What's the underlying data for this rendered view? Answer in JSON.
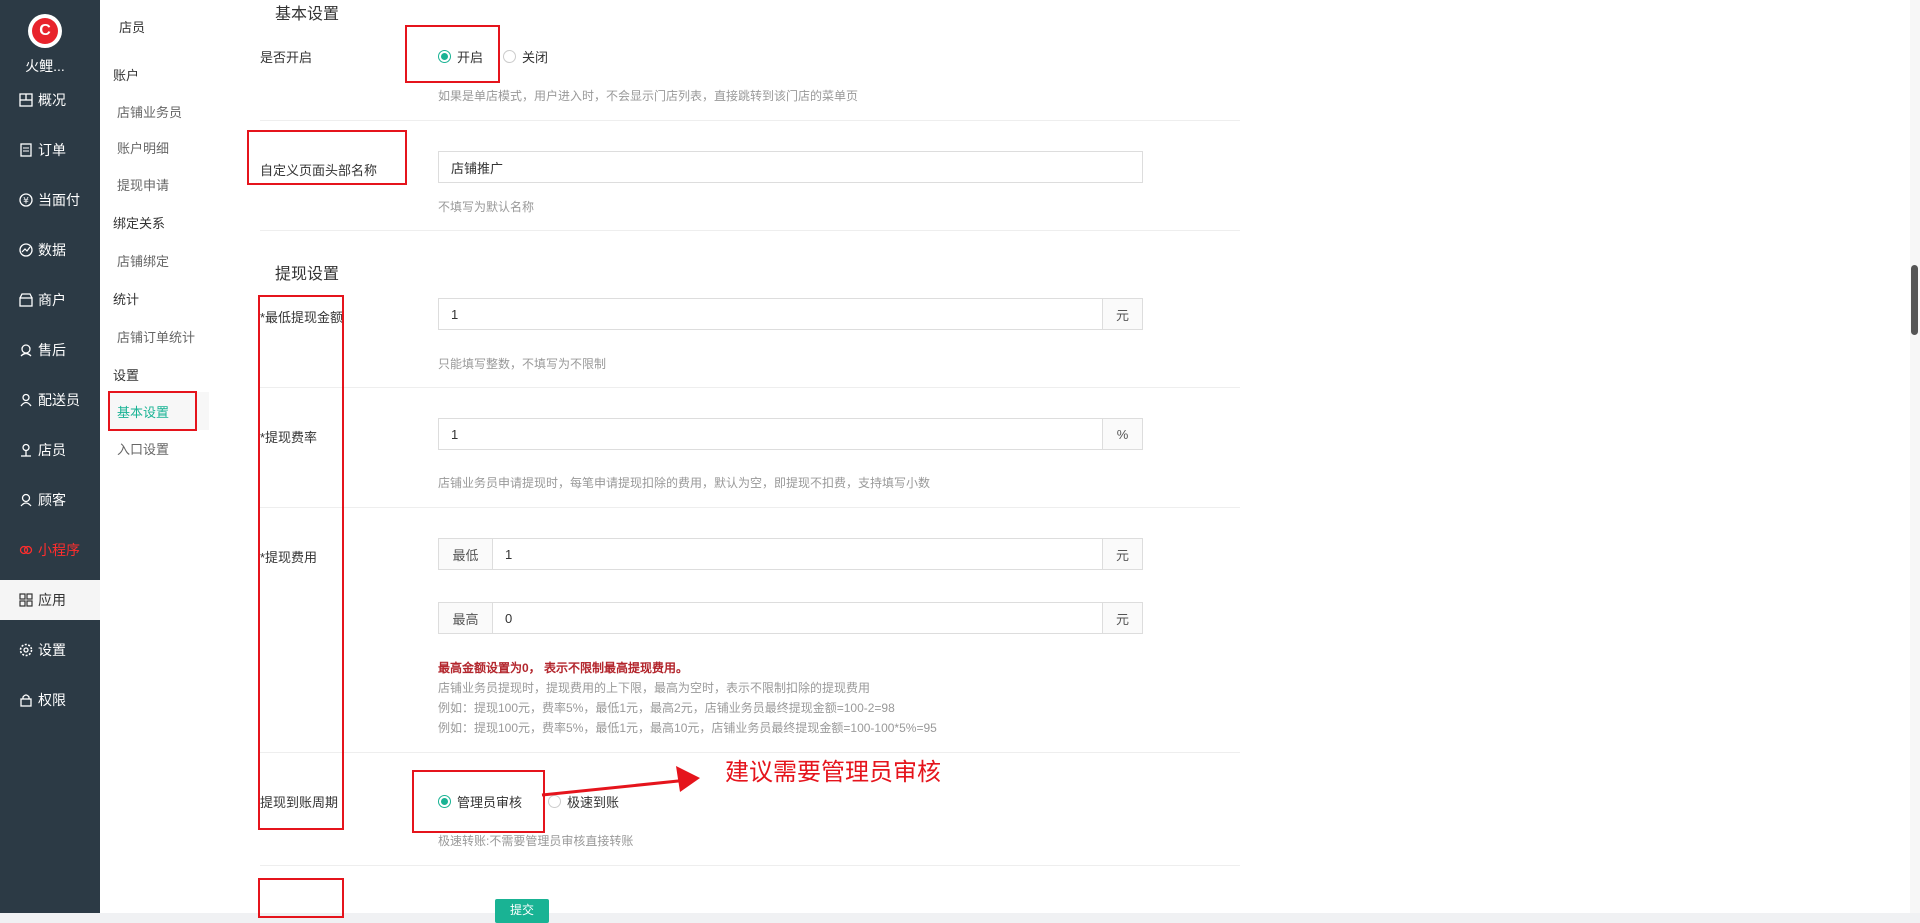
{
  "sidebar": {
    "shop_name": "火鲤...",
    "items": [
      {
        "label": "概况",
        "icon": "dashboard-icon"
      },
      {
        "label": "订单",
        "icon": "order-icon"
      },
      {
        "label": "当面付",
        "icon": "yen-icon"
      },
      {
        "label": "数据",
        "icon": "chart-icon"
      },
      {
        "label": "商户",
        "icon": "store-icon"
      },
      {
        "label": "售后",
        "icon": "service-icon"
      },
      {
        "label": "配送员",
        "icon": "courier-icon"
      },
      {
        "label": "店员",
        "icon": "clerk-icon"
      },
      {
        "label": "顾客",
        "icon": "customer-icon"
      },
      {
        "label": "小程序",
        "icon": "miniapp-icon"
      },
      {
        "label": "应用",
        "icon": "apps-icon"
      },
      {
        "label": "设置",
        "icon": "gear-icon"
      },
      {
        "label": "权限",
        "icon": "lock-icon"
      }
    ],
    "active_index": 10,
    "highlight_color": "#ff2d2d"
  },
  "subnav": {
    "top_item": "店员",
    "groups": [
      {
        "title": "账户",
        "items": [
          "店铺业务员",
          "账户明细",
          "提现申请"
        ]
      },
      {
        "title": "绑定关系",
        "items": [
          "店铺绑定"
        ]
      },
      {
        "title": "统计",
        "items": [
          "店铺订单统计"
        ]
      },
      {
        "title": "设置",
        "items": [
          "基本设置",
          "入口设置"
        ]
      }
    ],
    "active_item": "基本设置",
    "accent": "#19b394"
  },
  "basic": {
    "title": "基本设置",
    "enable_label": "是否开启",
    "enable_on": "开启",
    "enable_off": "关闭",
    "enable_help": "如果是单店模式，用户进入时，不会显示门店列表，直接跳转到该门店的菜单页",
    "header_label": "自定义页面头部名称",
    "header_value": "店铺推广",
    "header_help": "不填写为默认名称"
  },
  "withdraw": {
    "title": "提现设置",
    "min_label": "*最低提现金额",
    "min_value": "1",
    "min_unit": "元",
    "min_help": "只能填写整数，不填写为不限制",
    "rate_label": "*提现费率",
    "rate_value": "1",
    "rate_unit": "%",
    "rate_help": "店铺业务员申请提现时，每笔申请提现扣除的费用，默认为空，即提现不扣费，支持填写小数",
    "fee_label": "*提现费用",
    "fee_min_prefix": "最低",
    "fee_min_value": "1",
    "fee_max_prefix": "最高",
    "fee_max_value": "0",
    "fee_unit": "元",
    "fee_warning": "最高金额设置为0，  表示不限制最高提现费用。",
    "fee_note1": "店铺业务员提现时，提现费用的上下限，最高为空时，表示不限制扣除的提现费用",
    "fee_note2": "例如：提现100元，费率5%，最低1元，最高2元，店铺业务员最终提现金额=100-2=98",
    "fee_note3": "例如：提现100元，费率5%，最低1元，最高10元，店铺业务员最终提现金额=100-100*5%=95",
    "period_label": "提现到账周期",
    "period_admin": "管理员审核",
    "period_fast": "极速到账",
    "period_help": "极速转账:不需要管理员审核直接转账"
  },
  "annotation": "建议需要管理员审核",
  "submit_label": "提交"
}
